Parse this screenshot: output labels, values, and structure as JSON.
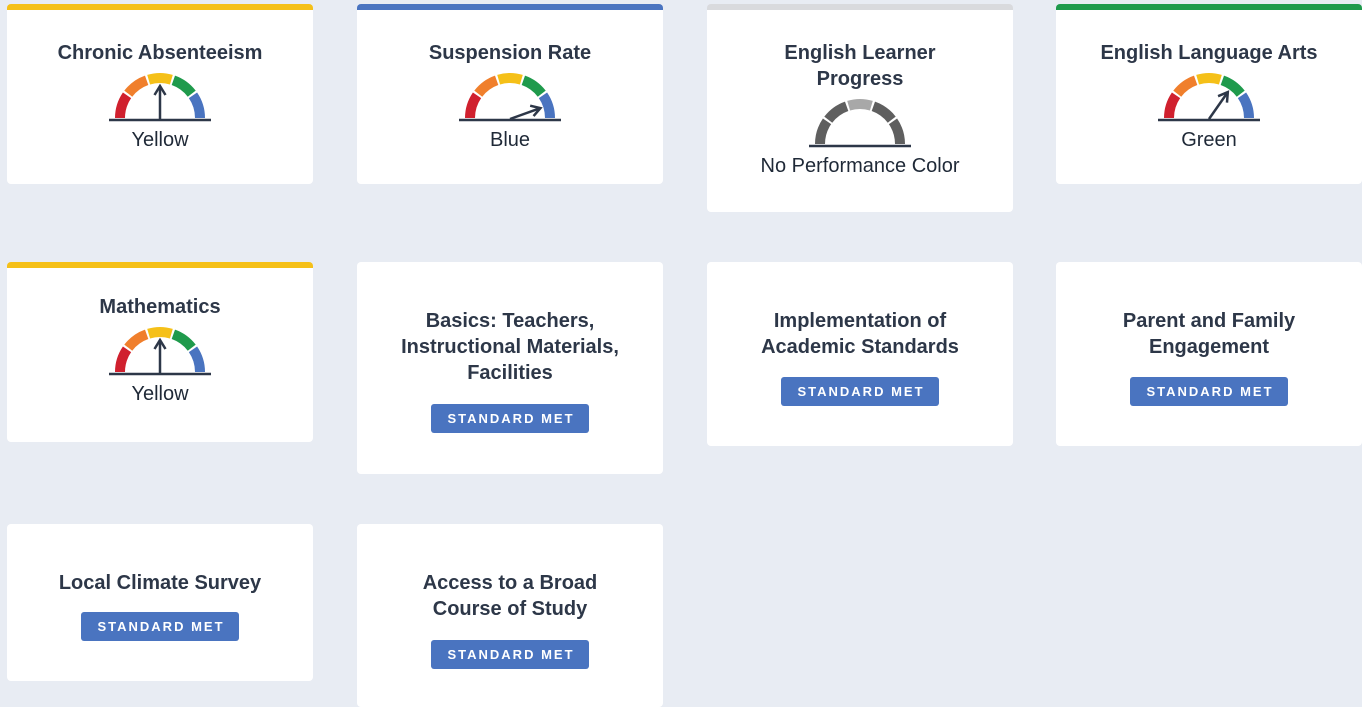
{
  "colors": {
    "red": "#d0202e",
    "orange": "#f07f2c",
    "yellow": "#f5c018",
    "green": "#1f9a4c",
    "blue": "#4a74c0",
    "gray_top": "#d9dadd",
    "gray_dark": "#5f5f5f",
    "gray_light": "#a8a8a8",
    "needle": "#2d3748",
    "badge_bg": "#4a74c0"
  },
  "indicators": [
    {
      "title": "Chronic Absenteeism",
      "status": "Yellow",
      "level": 3,
      "top_color": "#f5c018"
    },
    {
      "title": "Suspension Rate",
      "status": "Blue",
      "level": 5,
      "top_color": "#4a74c0"
    },
    {
      "title": "English Learner Progress",
      "status": "No Performance Color",
      "level": 0,
      "top_color": "#d9dadd"
    },
    {
      "title": "English Language Arts",
      "status": "Green",
      "level": 4,
      "top_color": "#1f9a4c"
    },
    {
      "title": "Mathematics",
      "status": "Yellow",
      "level": 3,
      "top_color": "#f5c018"
    }
  ],
  "local": [
    {
      "title": "Basics: Teachers, Instructional Materials, Facilities",
      "badge": "STANDARD MET"
    },
    {
      "title": "Implementation of Academic Standards",
      "badge": "STANDARD MET"
    },
    {
      "title": "Parent and Family Engagement",
      "badge": "STANDARD MET"
    },
    {
      "title": "Local Climate Survey",
      "badge": "STANDARD MET"
    },
    {
      "title": "Access to a Broad Course of Study",
      "badge": "STANDARD MET"
    }
  ]
}
